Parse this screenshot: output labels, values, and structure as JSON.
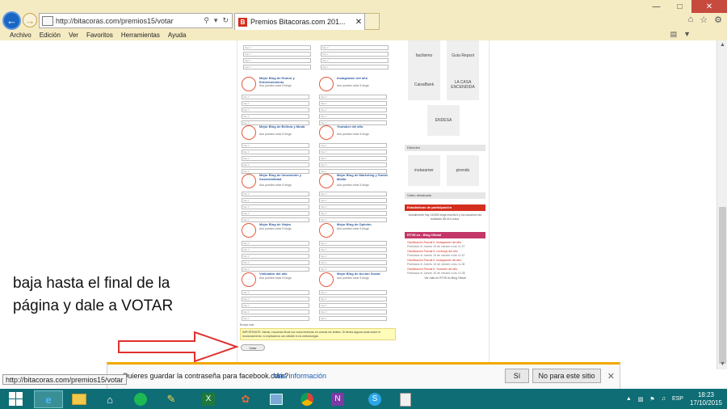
{
  "browser": {
    "url": "http://bitacoras.com/premios15/votar",
    "tab_title": "Premios Bitacoras.com 201...",
    "tab_favicon": "B",
    "menu": [
      "Archivo",
      "Edición",
      "Ver",
      "Favoritos",
      "Herramientas",
      "Ayuda"
    ],
    "status_url": "http://bitacoras.com/premios15/votar"
  },
  "categories": [
    {
      "title": "Mejor Blog de Humor y Entretenimiento",
      "note": "Aún puedes votar 5 blogs"
    },
    {
      "title": "Instagramer del año",
      "note": "Aún puedes votar 5 blogs"
    },
    {
      "title": "Mejor Blog de Belleza y Moda",
      "note": "Aún puedes votar 5 blogs"
    },
    {
      "title": "Youtuber del año",
      "note": "Aún puedes votar 5 blogs"
    },
    {
      "title": "Mejor Blog de Innovación y Sostenibilidad",
      "note": "Aún puedes votar 5 blogs"
    },
    {
      "title": "Mejor Blog de Marketing y Social Media",
      "note": "Aún puedes votar 5 blogs"
    },
    {
      "title": "Mejor Blog de Viajes",
      "note": "Aún puedes votar 5 blogs"
    },
    {
      "title": "Mejor Blog de Opinión",
      "note": "Aún puedes votar 5 blogs"
    },
    {
      "title": "Viniloador del año",
      "note": "Aún puedes votar 5 blogs"
    },
    {
      "title": "Mejor Blog de Acción Social",
      "note": "Aún puedes votar 5 blogs"
    }
  ],
  "input_placeholder": "http://",
  "sidebar": {
    "logos": [
      "facilisimo",
      "Guía Repsol",
      "CaixaBank",
      "LA CASA ENCENDIDA",
      "ENDESA"
    ],
    "difunden": "Difunden",
    "difunden_logos": [
      "instaramer",
      "pirendo"
    ],
    "video": "Vídeo destacado",
    "stats_title": "Estadísticas de participación",
    "stats_text": "Actualmente hay 18.826 blogs inscrito’s y los usuarios han realizado 68.314 votos.",
    "news_title": "RTVE.es - Blog Oficial",
    "news": [
      {
        "title": "Clasificación Parcial II: Instagramer del año",
        "date": "Publicado el Jueves 15 de octubre a las 11:37"
      },
      {
        "title": "Clasificación Parcial II: Lector(a) del año",
        "date": "Publicado el Jueves 15 de octubre a las 11:22"
      },
      {
        "title": "Clasificación Parcial II: Instagramer del año",
        "date": "Publicado el Jueves 15 de octubre a las 11:08"
      },
      {
        "title": "Clasificación Parcial II: Youtuber del año",
        "date": "Publicado el Jueves 15 de octubre a las 10:38"
      }
    ],
    "more": "Ver más en RTVE.es Blog Oficial"
  },
  "form": {
    "footer_note": "Enviar voto",
    "warning": "IMPORTANTE: Atento, recuerda llevar tus votos teniendo en cuenta los límites. Si tienes alguna duda sobre el funcionamiento, lo explicamos con detalle en la metodología.",
    "vote_button": "Votar"
  },
  "instruction": "baja hasta el final de la página y dale a VOTAR",
  "notification": {
    "message": "¿Quieres guardar la contraseña para facebook.com?",
    "more": "Más información",
    "yes": "Sí",
    "no": "No para este sitio"
  },
  "taskbar": {
    "time": "18:23",
    "date": "17/10/2015",
    "lang": "ESP"
  }
}
